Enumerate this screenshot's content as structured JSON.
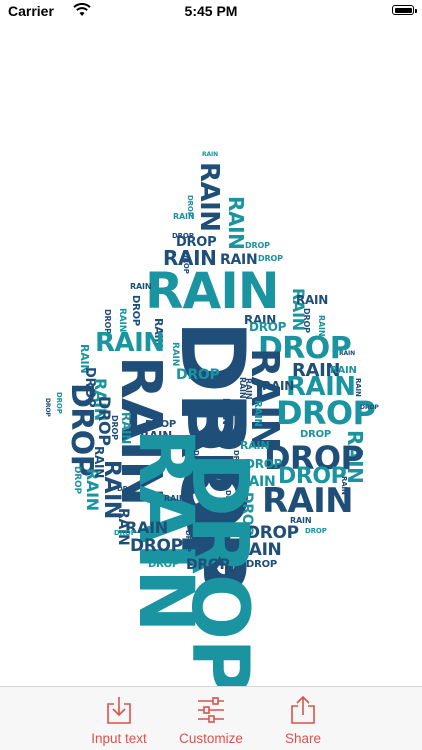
{
  "status_bar": {
    "carrier": "Carrier",
    "time": "5:45 PM"
  },
  "words": {
    "rain": "RAIN",
    "drop": "DROP"
  },
  "colors": {
    "dark": "#1f4e79",
    "teal": "#1a94a0",
    "accent": "#d9534f"
  },
  "toolbar": {
    "input_text": "Input text",
    "customize": "Customize",
    "share": "Share"
  }
}
